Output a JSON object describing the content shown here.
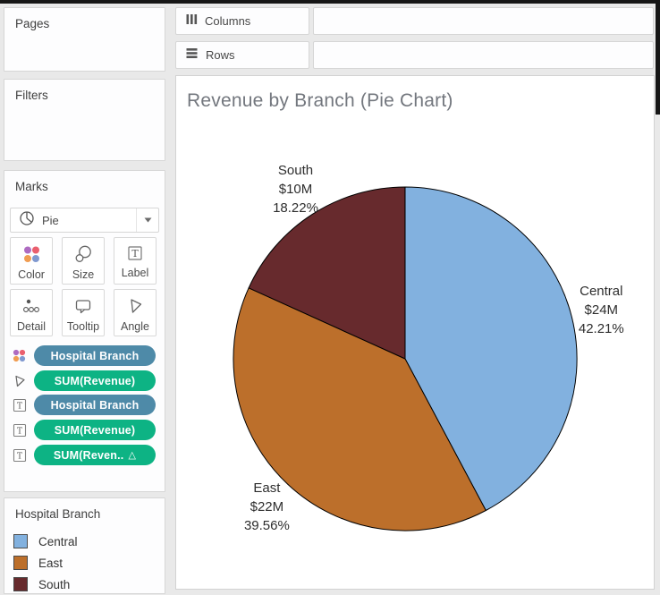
{
  "left_panel": {
    "pages": {
      "label": "Pages"
    },
    "filters": {
      "label": "Filters"
    },
    "marks": {
      "label": "Marks",
      "mark_type_dropdown": {
        "value": "Pie"
      },
      "buttons": [
        {
          "label": "Color"
        },
        {
          "label": "Size"
        },
        {
          "label": "Label"
        },
        {
          "label": "Detail"
        },
        {
          "label": "Tooltip"
        },
        {
          "label": "Angle"
        }
      ],
      "pills": [
        {
          "text": "Hospital Branch",
          "kind": "dimension",
          "color": "#4e8aa8",
          "suffix": ""
        },
        {
          "text": "SUM(Revenue)",
          "kind": "measure",
          "color": "#0db384",
          "suffix": ""
        },
        {
          "text": "Hospital Branch",
          "kind": "dimension",
          "color": "#4e8aa8",
          "suffix": ""
        },
        {
          "text": "SUM(Revenue)",
          "kind": "measure",
          "color": "#0db384",
          "suffix": ""
        },
        {
          "text": "SUM(Reven..",
          "kind": "measure",
          "color": "#0db384",
          "suffix": "△"
        }
      ]
    },
    "legend": {
      "title": "Hospital Branch",
      "items": [
        {
          "label": "Central",
          "color": "#82b1df"
        },
        {
          "label": "East",
          "color": "#bc6f2b"
        },
        {
          "label": "South",
          "color": "#672a2d"
        }
      ]
    }
  },
  "shelves": {
    "columns": {
      "label": "Columns"
    },
    "rows": {
      "label": "Rows"
    }
  },
  "chart_data": {
    "type": "pie",
    "title": "Revenue by Branch (Pie Chart)",
    "categories": [
      "Central",
      "East",
      "South"
    ],
    "values": [
      24,
      22,
      10
    ],
    "value_labels": [
      "$24M",
      "$22M",
      "$10M"
    ],
    "percents": [
      42.21,
      39.56,
      18.22
    ],
    "percent_labels": [
      "42.21%",
      "39.56%",
      "18.22%"
    ],
    "colors": [
      "#82b1df",
      "#bc6f2b",
      "#672a2d"
    ],
    "start_angle_deg": 0,
    "direction": "clockwise",
    "slice_border_color": "#000000",
    "label_text_color": "#2d2d2d",
    "legend_position": "left-panel"
  }
}
